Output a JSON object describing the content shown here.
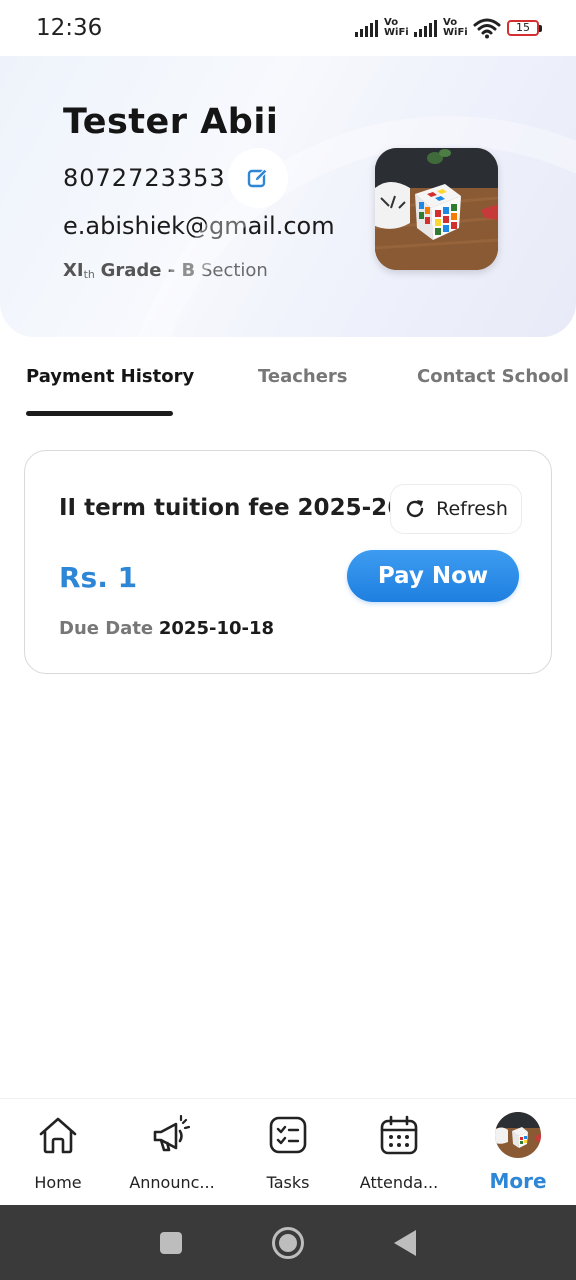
{
  "status_bar": {
    "time": "12:36",
    "network_1": "Vo WiFi",
    "network_2": "Vo WiFi",
    "battery_level": "15",
    "icons": [
      "signal-icon",
      "vowifi-icon",
      "signal-icon",
      "vowifi-icon",
      "wifi-icon",
      "battery-icon"
    ]
  },
  "profile": {
    "name": "Tester Abii",
    "phone": "8072723353",
    "email": "e.abishiek@gmail.com",
    "grade_main": "XI",
    "grade_suffix": "th",
    "grade_label": "Grade - B",
    "section_label": "Section",
    "edit_icon": "edit-icon",
    "photo": "rubiks-cube-photo"
  },
  "tabs": [
    {
      "label": "Payment History",
      "active": true
    },
    {
      "label": "Teachers",
      "active": false
    },
    {
      "label": "Contact School",
      "active": false
    }
  ],
  "fee": {
    "title": "II term tuition fee 2025-26",
    "refresh_label": "Refresh",
    "amount": "Rs. 1",
    "pay_label": "Pay Now",
    "due_label": "Due Date",
    "due_value": "2025-10-18"
  },
  "bottom_nav": [
    {
      "label": "Home",
      "icon": "home-icon",
      "active": false
    },
    {
      "label": "Announc...",
      "icon": "megaphone-icon",
      "active": false
    },
    {
      "label": "Tasks",
      "icon": "tasks-icon",
      "active": false
    },
    {
      "label": "Attenda...",
      "icon": "calendar-icon",
      "active": false
    },
    {
      "label": "More",
      "icon": "avatar",
      "active": true
    }
  ],
  "colors": {
    "accent": "#2e86d6",
    "pay_button": "#1f7fe0",
    "battery_low": "#d32f2f"
  }
}
